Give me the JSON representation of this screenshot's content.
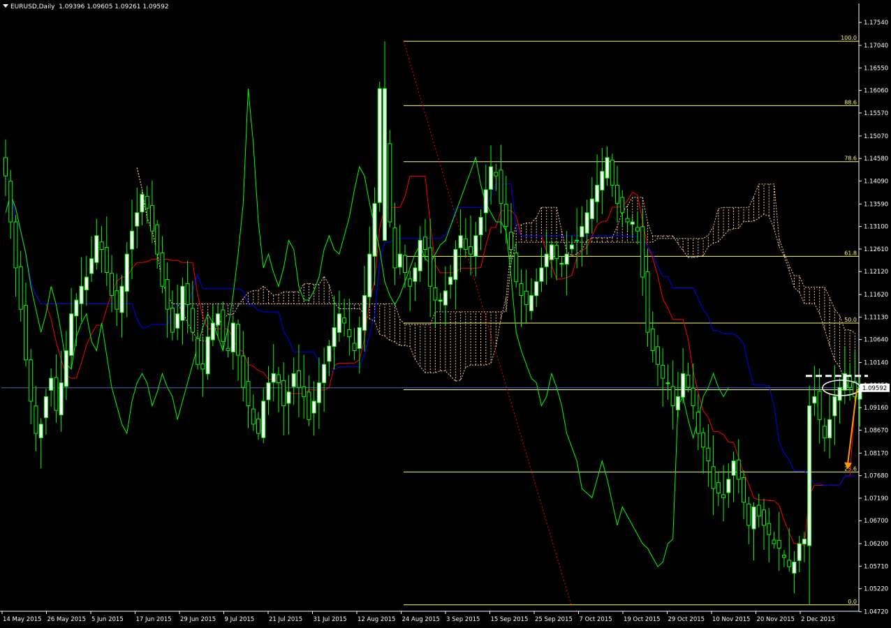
{
  "header": {
    "symbol": "EURUSD,Daily",
    "ohlc": "1.09396 1.09605 1.09261 1.09592"
  },
  "colors": {
    "background": "#000000",
    "axis": "#ffffff",
    "candle_up": "#ffffff",
    "candle_down": "#000000",
    "candle_outline": "#00ff00",
    "tenkan": "#ff0000",
    "kijun": "#0000ff",
    "chikou": "#00ff00",
    "cloud": "#ffcc99",
    "fibo": "#ffff66",
    "fibo_trend": "#ff0000",
    "bid_line": "#4a6fb5",
    "annotation_arrow": "#ff9900",
    "annotation_marks": "#ffffff"
  },
  "chart_data": {
    "type": "candlestick",
    "title": "EURUSD,Daily",
    "ohlc_label": "1.09396 1.09605 1.09261 1.09592",
    "ylim": [
      1.0473,
      1.178
    ],
    "x_tick_labels": [
      "14 May 2015",
      "26 May 2015",
      "5 Jun 2015",
      "17 Jun 2015",
      "29 Jun 2015",
      "9 Jul 2015",
      "21 Jul 2015",
      "31 Jul 2015",
      "12 Aug 2015",
      "24 Aug 2015",
      "3 Sep 2015",
      "15 Sep 2015",
      "25 Sep 2015",
      "7 Oct 2015",
      "19 Oct 2015",
      "29 Oct 2015",
      "10 Nov 2015",
      "20 Nov 2015",
      "2 Dec 2015"
    ],
    "y_tick_labels": [
      "1.17540",
      "1.17040",
      "1.16550",
      "1.16060",
      "1.15570",
      "1.15070",
      "1.14580",
      "1.14090",
      "1.13590",
      "1.13100",
      "1.12610",
      "1.12120",
      "1.11620",
      "1.11130",
      "1.10640",
      "1.10140",
      "1.09650",
      "1.09160",
      "1.08670",
      "1.08170",
      "1.07680",
      "1.07190",
      "1.06700",
      "1.06200",
      "1.05710",
      "1.05220",
      "1.04720"
    ],
    "current_price": "1.09592",
    "fibo": {
      "high": 1.1713,
      "low": 1.0487,
      "levels": [
        {
          "label": "100.0",
          "value": 1.1713
        },
        {
          "label": "88.6",
          "value": 1.1573
        },
        {
          "label": "78.6",
          "value": 1.1451
        },
        {
          "label": "61.8",
          "value": 1.1245
        },
        {
          "label": "50.0",
          "value": 1.11
        },
        {
          "label": "38.2",
          "value": 1.0955
        },
        {
          "label": "23.6",
          "value": 1.0776
        },
        {
          "label": "0.0",
          "value": 1.0487
        }
      ]
    },
    "annotation": {
      "ellipse_price": 1.0959,
      "dashed_level": 1.0985,
      "arrow_from": 1.0955,
      "arrow_to": 1.0782
    },
    "close": [
      1.142,
      1.132,
      1.122,
      1.113,
      1.102,
      1.093,
      1.086,
      1.088,
      1.094,
      1.098,
      1.091,
      1.097,
      1.104,
      1.112,
      1.115,
      1.118,
      1.12,
      1.124,
      1.129,
      1.126,
      1.121,
      1.116,
      1.113,
      1.118,
      1.125,
      1.13,
      1.134,
      1.138,
      1.135,
      1.13,
      1.125,
      1.118,
      1.113,
      1.108,
      1.112,
      1.118,
      1.114,
      1.108,
      1.101,
      1.1,
      1.107,
      1.11,
      1.112,
      1.106,
      1.104,
      1.11,
      1.103,
      1.096,
      1.092,
      1.088,
      1.086,
      1.093,
      1.097,
      1.099,
      1.097,
      1.092,
      1.095,
      1.099,
      1.096,
      1.094,
      1.089,
      1.093,
      1.097,
      1.101,
      1.105,
      1.109,
      1.112,
      1.11,
      1.107,
      1.104,
      1.109,
      1.116,
      1.125,
      1.136,
      1.161,
      1.149,
      1.132,
      1.122,
      1.125,
      1.121,
      1.118,
      1.122,
      1.128,
      1.126,
      1.118,
      1.115,
      1.115,
      1.117,
      1.12,
      1.126,
      1.129,
      1.126,
      1.125,
      1.129,
      1.133,
      1.139,
      1.144,
      1.142,
      1.136,
      1.131,
      1.126,
      1.119,
      1.116,
      1.114,
      1.116,
      1.119,
      1.122,
      1.125,
      1.127,
      1.124,
      1.123,
      1.125,
      1.127,
      1.128,
      1.131,
      1.134,
      1.137,
      1.14,
      1.143,
      1.146,
      1.14,
      1.136,
      1.134,
      1.132,
      1.132,
      1.13,
      1.12,
      1.108,
      1.104,
      1.101,
      1.098,
      1.097,
      1.092,
      1.094,
      1.099,
      1.096,
      1.092,
      1.086,
      1.083,
      1.08,
      1.074,
      1.073,
      1.072,
      1.076,
      1.08,
      1.076,
      1.071,
      1.066,
      1.07,
      1.068,
      1.066,
      1.064,
      1.062,
      1.061,
      1.059,
      1.057,
      1.058,
      1.062,
      1.063,
      1.092,
      1.094,
      1.089,
      1.085,
      1.089,
      1.094,
      1.096,
      1.099,
      1.096,
      1.094,
      1.0959
    ]
  }
}
